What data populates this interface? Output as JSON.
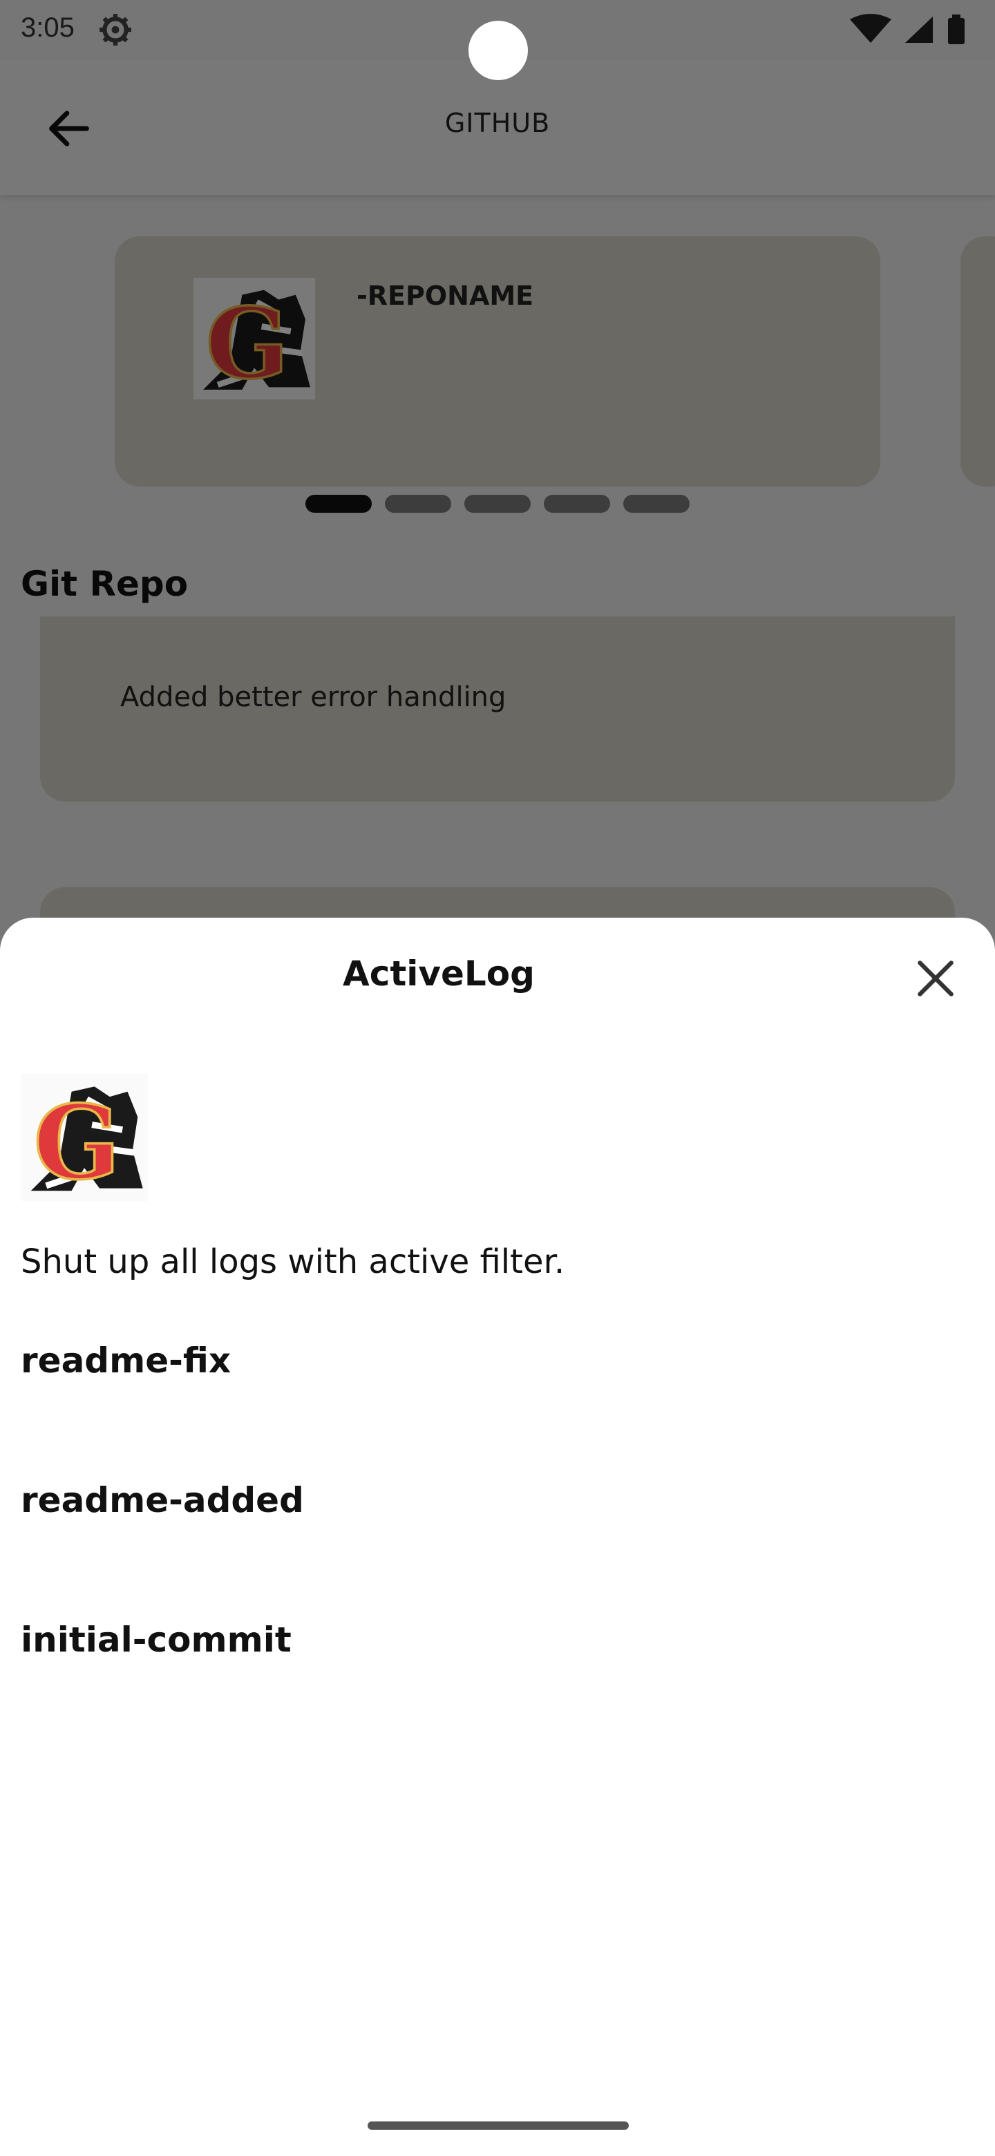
{
  "status_bar": {
    "time": "3:05"
  },
  "app_bar": {
    "title": "GITHUB"
  },
  "carousel": {
    "card_name": "-REPONAME",
    "page_count": 5,
    "active_page": 1
  },
  "repo_section": {
    "title": "Git Repo",
    "commit_message": "Added better error handling"
  },
  "sheet": {
    "title": "ActiveLog",
    "description": "Shut up all logs with active filter.",
    "items": [
      {
        "label": "readme-fix"
      },
      {
        "label": "readme-added"
      },
      {
        "label": "initial-commit"
      }
    ]
  },
  "colors": {
    "card_bg": "#d6d3c6",
    "logo_red": "#e0393c",
    "logo_gold": "#e8b84a"
  },
  "icons": [
    "settings-gear-icon",
    "wifi-icon",
    "cellular-signal-icon",
    "battery-icon",
    "back-arrow-icon",
    "close-icon",
    "repo-logo-icon"
  ]
}
